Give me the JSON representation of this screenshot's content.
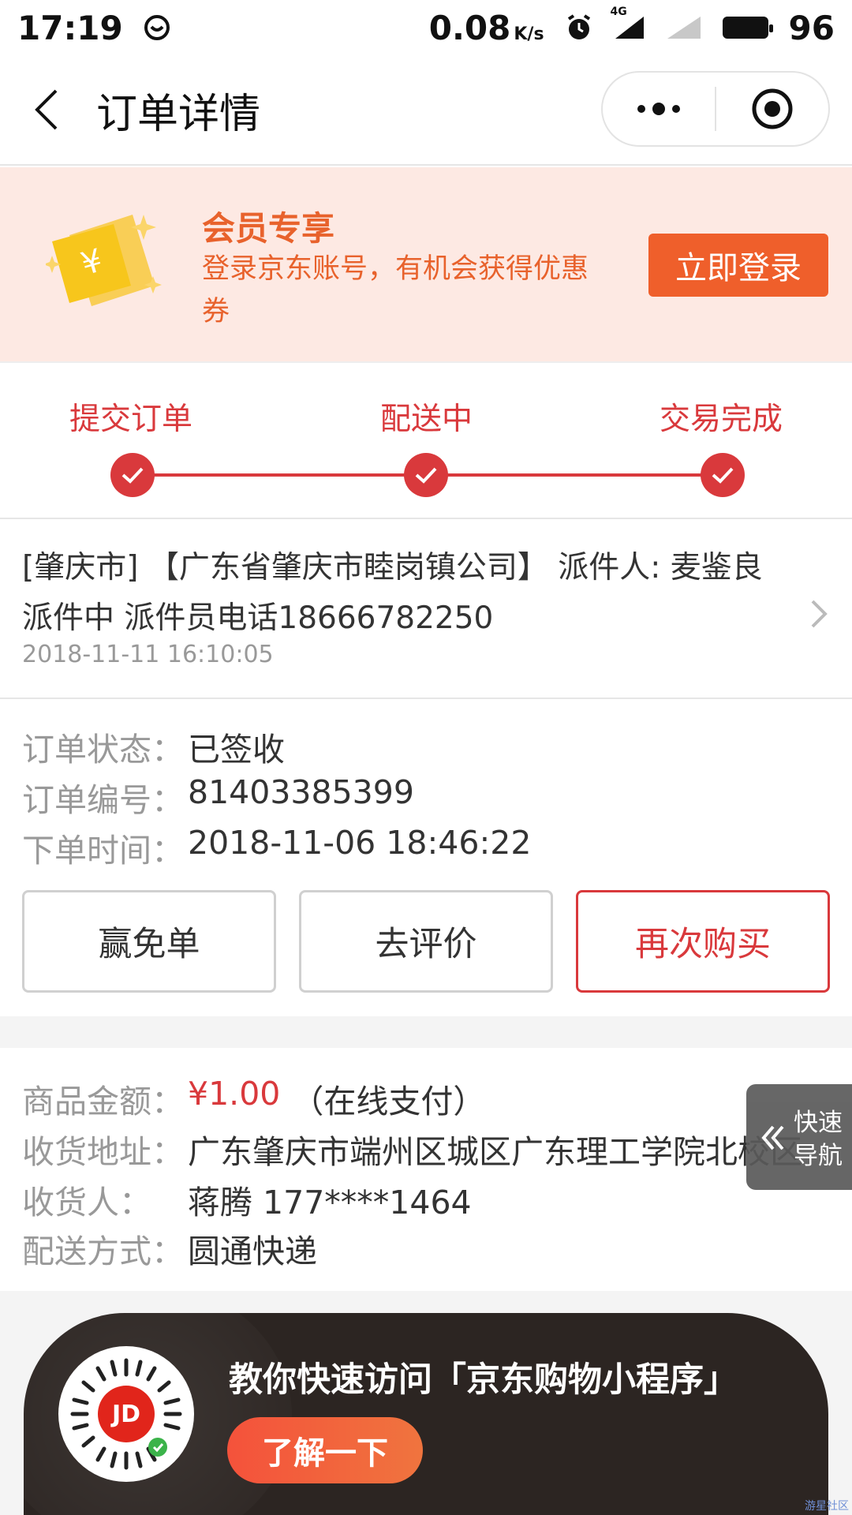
{
  "status_bar": {
    "time": "17:19",
    "speed": "0.08",
    "speed_unit": "K/s",
    "network": "4G",
    "battery": "96"
  },
  "nav": {
    "title": "订单详情"
  },
  "member": {
    "title": "会员专享",
    "desc": "登录京东账号，有机会获得优惠券",
    "login_label": "立即登录"
  },
  "progress": {
    "steps": [
      {
        "label": "提交订单"
      },
      {
        "label": "配送中"
      },
      {
        "label": "交易完成"
      }
    ],
    "color": "#d9393c"
  },
  "logistics": {
    "text": "[肇庆市] 【广东省肇庆市睦岗镇公司】 派件人: 麦鉴良 派件中 派件员电话18666782250",
    "time": "2018-11-11 16:10:05"
  },
  "order": {
    "status_label": "订单状态：",
    "status": "已签收",
    "number_label": "订单编号：",
    "number": "81403385399",
    "time_label": "下单时间：",
    "time": "2018-11-06 18:46:22"
  },
  "actions": {
    "free_label": "赢免单",
    "review_label": "去评价",
    "rebuy_label": "再次购买"
  },
  "delivery": {
    "amount_label": "商品金额：",
    "amount": "¥1.00",
    "pay_method": "（在线支付）",
    "address_label": "收货地址：",
    "address": "广东肇庆市端州区城区广东理工学院北校区",
    "receiver_label": "收货人：",
    "receiver": "蒋腾 177****1464",
    "ship_label": "配送方式：",
    "ship": "圆通快递"
  },
  "float_nav": {
    "label": "快速导航"
  },
  "promo": {
    "title": "教你快速访问「京东购物小程序」",
    "button": "了解一下",
    "badge": "JD"
  },
  "watermark": "游星社区"
}
